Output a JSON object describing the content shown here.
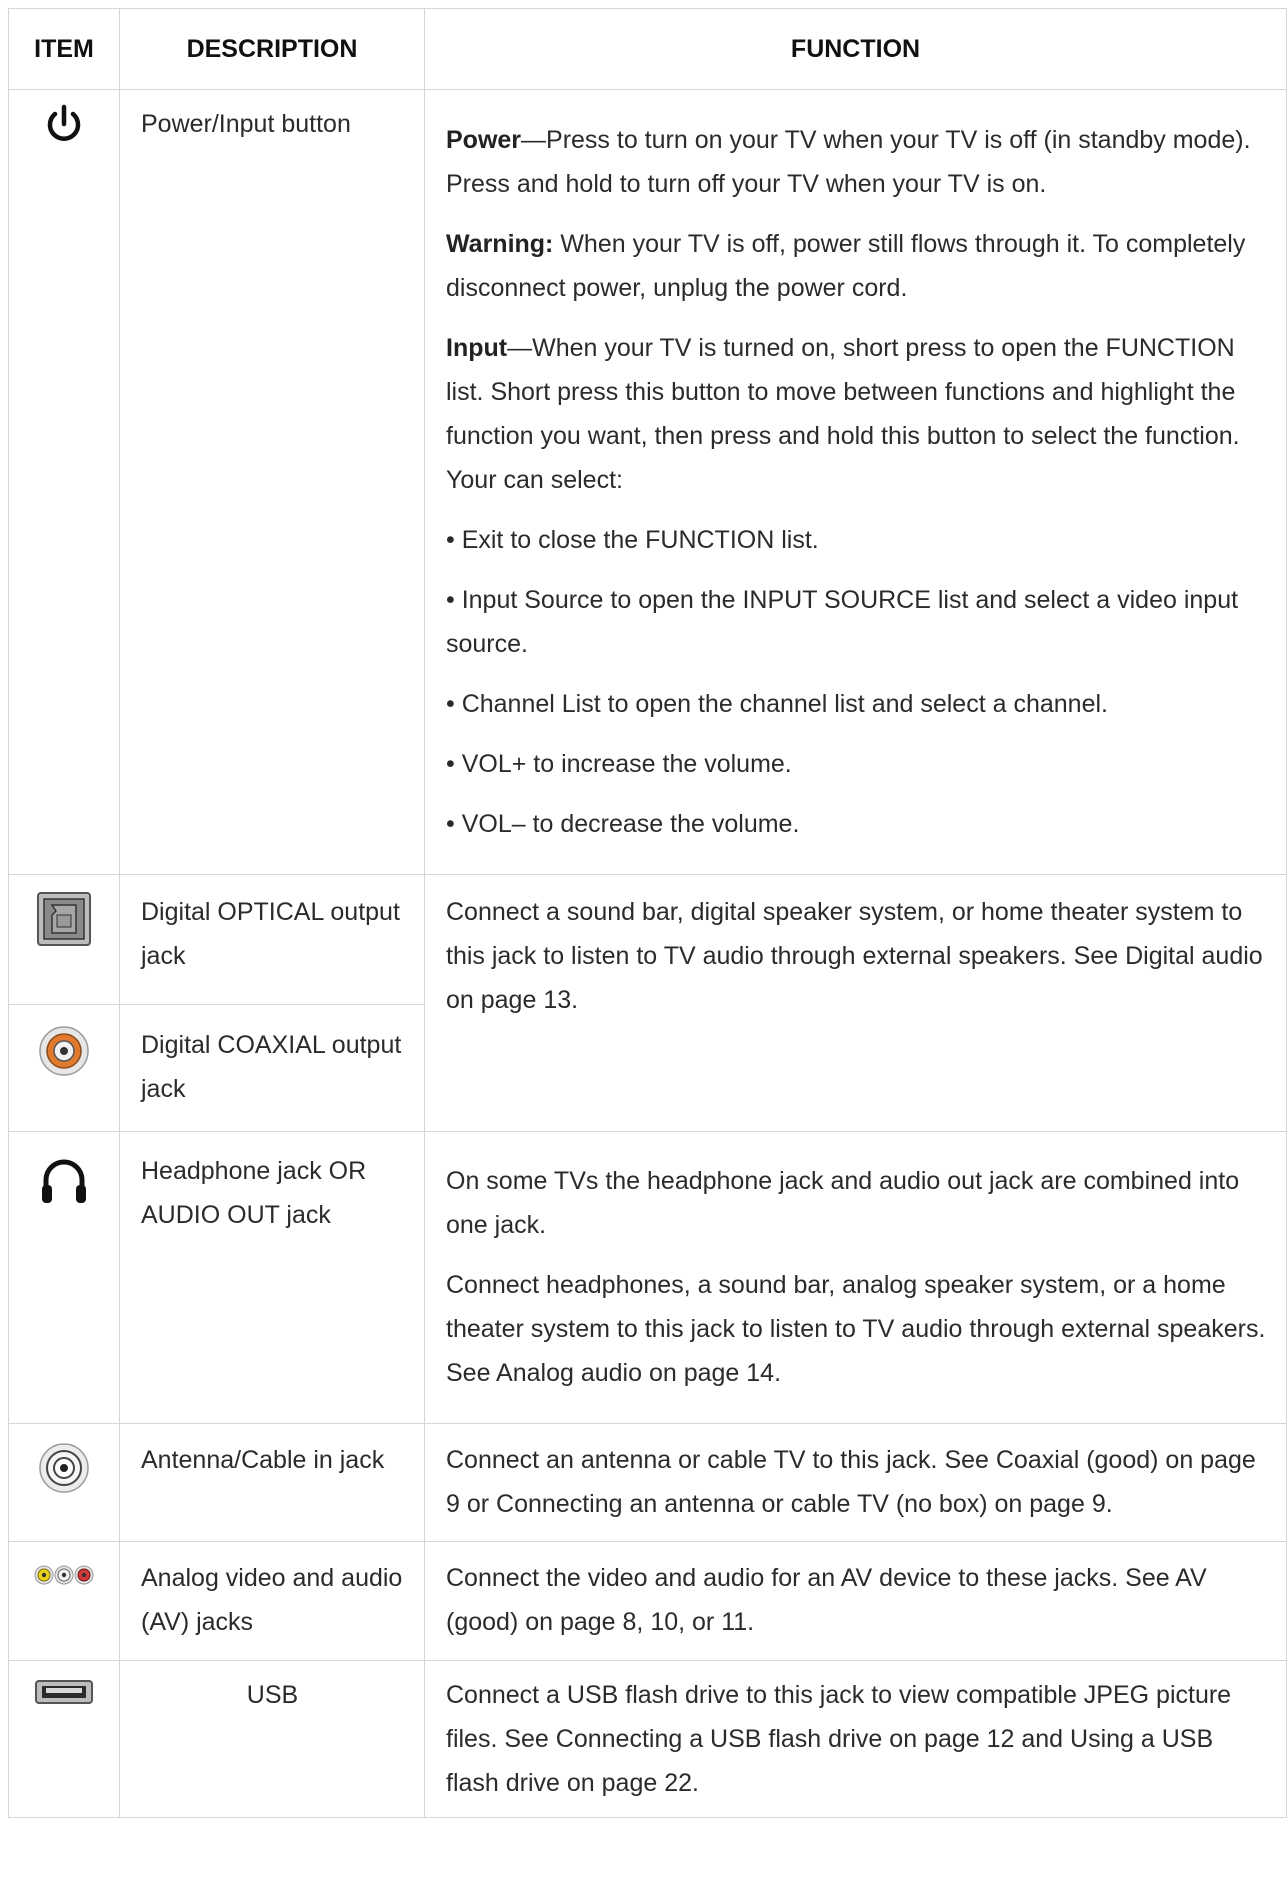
{
  "headers": {
    "item": "ITEM",
    "description": "DESCRIPTION",
    "function": "FUNCTION"
  },
  "rows": {
    "power": {
      "icon": "power-icon",
      "description": "Power/Input button",
      "p1_bold": "Power",
      "p1_text": "—Press to turn on your TV when your TV is off (in standby mode). Press and hold to turn off your TV when your TV is on.",
      "p2_bold": "Warning:",
      "p2_text": " When your TV is off, power still flows through it. To completely disconnect power, unplug the power cord.",
      "p3_bold": "Input",
      "p3_text": "—When your TV is turned on, short press to open the FUNCTION list. Short press this button to move between functions and highlight the function you want, then press and hold this button to select the function. Your can select:",
      "bullets": [
        "• Exit to close the FUNCTION list.",
        "• Input Source to open the INPUT SOURCE list and select a video input source.",
        "• Channel List to open the channel list and select a channel.",
        "• VOL+ to increase the volume.",
        "• VOL– to decrease the volume."
      ]
    },
    "optical": {
      "icon": "optical-jack-icon",
      "description": "Digital OPTICAL output jack",
      "function": "Connect a sound bar, digital speaker system, or home theater system to this jack to listen to TV audio through external speakers. See Digital audio on page 13."
    },
    "coaxial_out": {
      "icon": "coaxial-out-jack-icon",
      "description": "Digital COAXIAL output jack"
    },
    "headphone": {
      "icon": "headphone-icon",
      "description": "Headphone jack OR AUDIO OUT jack",
      "p1": "On some TVs the headphone jack and audio out jack are combined into one jack.",
      "p2": "Connect headphones, a sound bar, analog speaker system, or a home theater system to this jack to listen to TV audio through external speakers. See Analog audio on page 14."
    },
    "antenna": {
      "icon": "antenna-jack-icon",
      "description": "Antenna/Cable in jack",
      "function": "Connect an antenna or cable TV to this jack. See Coaxial (good) on page 9 or Connecting an antenna or cable TV (no box) on page 9."
    },
    "av": {
      "icon": "av-jacks-icon",
      "description": "Analog video and audio (AV) jacks",
      "function": "Connect the video and audio for an AV device to these jacks. See AV (good) on page 8, 10, or 11."
    },
    "usb": {
      "icon": "usb-icon",
      "description": "USB",
      "function": "Connect a USB flash drive to this jack to view compatible JPEG picture files. See Connecting a USB flash drive on page 12 and Using a USB flash drive on page 22."
    }
  },
  "colors": {
    "border": "#d6d6d6",
    "text": "#2b2b2b",
    "coax_orange": "#e07a2e",
    "av_yellow": "#e8d21c",
    "av_red": "#d23a3a"
  }
}
